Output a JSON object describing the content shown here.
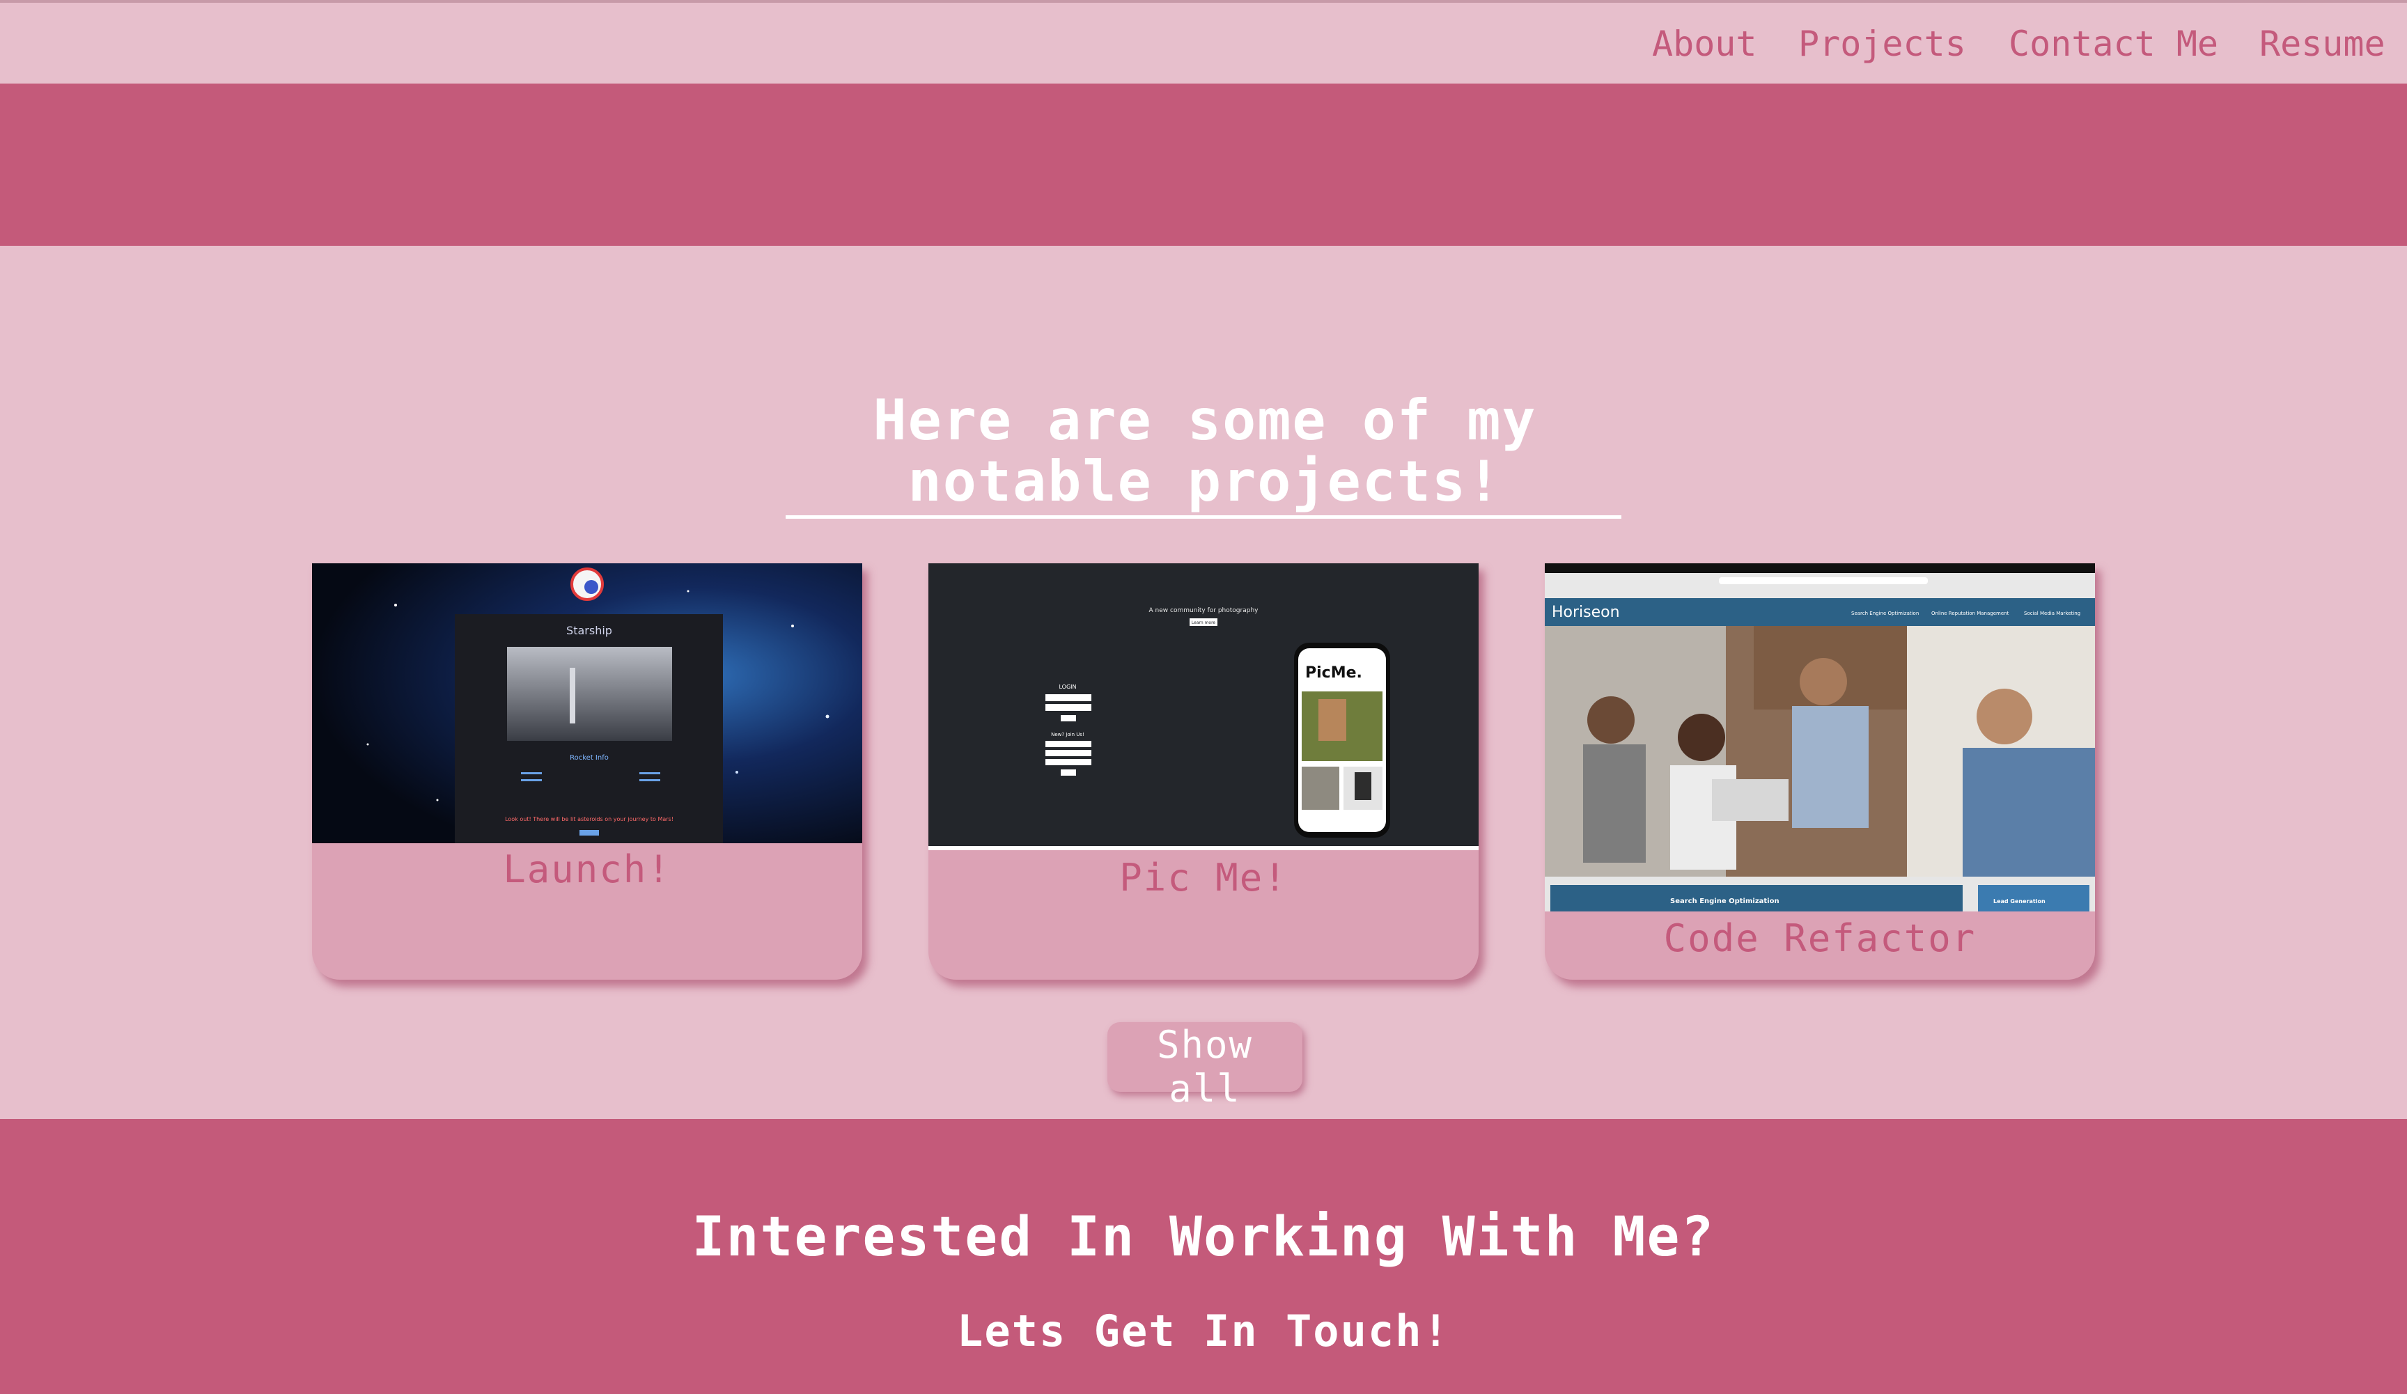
{
  "nav": {
    "about": "About",
    "projects": "Projects",
    "contact": "Contact Me",
    "resume": "Resume"
  },
  "projects_section": {
    "heading_line1": "Here are some of my",
    "heading_line2": "notable projects!"
  },
  "cards": [
    {
      "title": "Launch!",
      "screenshot": {
        "page_title": "Starship",
        "section_label": "Rocket Info",
        "warning_text": "Look out! There will be lit asteroids on your journey to Mars!"
      }
    },
    {
      "title": "Pic Me!",
      "screenshot": {
        "tagline": "A new community for photography",
        "cta": "Learn more",
        "login_label": "LOGIN",
        "join_label": "New? Join Us!",
        "app_name": "PicMe."
      }
    },
    {
      "title": "Code Refactor",
      "screenshot": {
        "brand": "Horiseon",
        "nav_items": [
          "Search Engine Optimization",
          "Online Reputation Management",
          "Social Media Marketing"
        ],
        "section_a": "Search Engine Optimization",
        "section_b": "Lead Generation"
      }
    }
  ],
  "show_all_label": "Show all",
  "footer": {
    "title": "Interested In Working With Me?",
    "subtitle": "Lets Get In Touch!"
  },
  "colors": {
    "page_bg": "#e7bfcc",
    "band": "#c45a7a",
    "card": "#dca2b5",
    "accent_text": "#c45a7c"
  }
}
